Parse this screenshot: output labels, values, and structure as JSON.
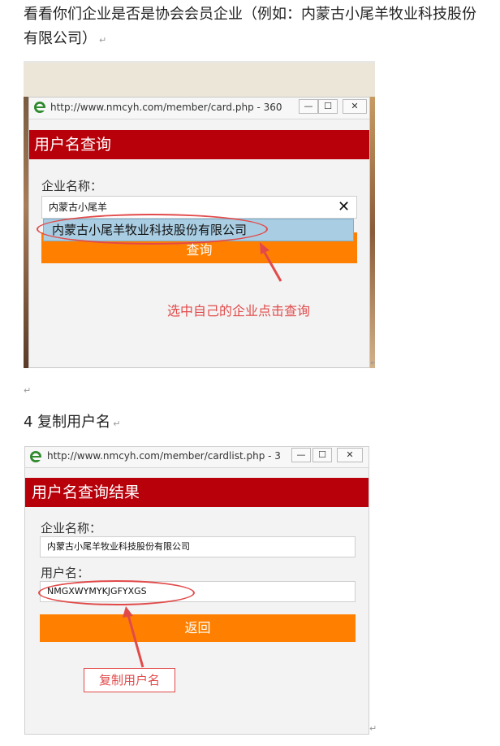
{
  "intro": {
    "text": "看看你们企业是否是协会会员企业（例如：内蒙古小尾羊牧业科技股份有限公司）",
    "return_mark": "↵"
  },
  "step4": {
    "text": "4 复制用户名",
    "return_mark": "↵"
  },
  "empty_line_mark": "↵",
  "window1": {
    "url": "http://www.nmcyh.com/member/card.php - 360",
    "minimize": "—",
    "maximize": "☐",
    "close": "✕",
    "header": "用户名查询",
    "company_label": "企业名称：",
    "company_input": "内蒙古小尾羊",
    "clear_icon": "✕",
    "suggestion": "内蒙古小尾羊牧业科技股份有限公司",
    "query_button": "查询",
    "annotation": "选中自己的企业点击查询",
    "end_mark": "↵"
  },
  "window2": {
    "url": "http://www.nmcyh.com/member/cardlist.php - 3",
    "minimize": "—",
    "maximize": "☐",
    "close": "✕",
    "header": "用户名查询结果",
    "company_label": "企业名称：",
    "company_value": "内蒙古小尾羊牧业科技股份有限公司",
    "username_label": "用户名：",
    "username_value": "NMGXWYMYKJGFYXGS",
    "back_button": "返回",
    "annotation": "复制用户名",
    "end_mark": "↵"
  },
  "colors": {
    "header_red": "#b8000a",
    "button_orange": "#ff8000",
    "annotation_red": "#e24a4a",
    "suggestion_blue": "#a9cde2"
  },
  "icons": [
    "ie-browser-icon",
    "minimize-icon",
    "maximize-icon",
    "close-icon",
    "clear-input-icon",
    "arrow-icon"
  ]
}
